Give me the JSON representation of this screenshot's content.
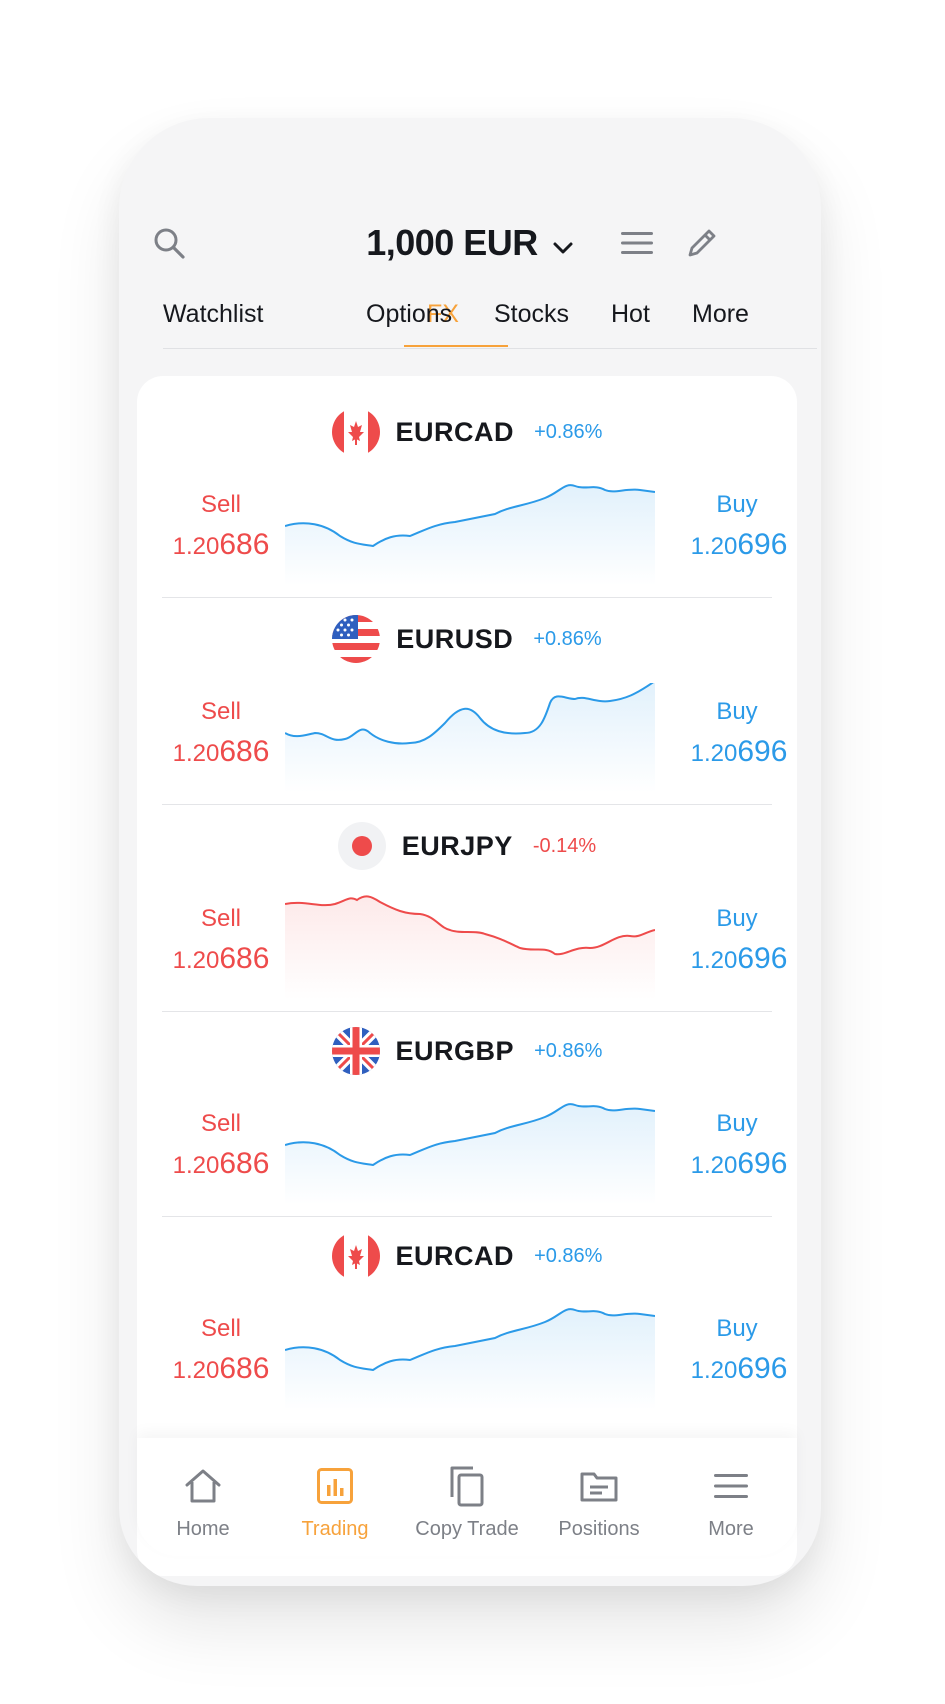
{
  "header": {
    "balance": "1,000 EUR",
    "icons": [
      "search-icon",
      "chevron-down-icon",
      "menu-icon",
      "pencil-icon"
    ]
  },
  "tabs": [
    {
      "label": "Watchlist",
      "active": false
    },
    {
      "label": "FX",
      "active": true
    },
    {
      "label": "Options",
      "active": false
    },
    {
      "label": "Stocks",
      "active": false
    },
    {
      "label": "Hot",
      "active": false
    },
    {
      "label": "More",
      "active": false
    }
  ],
  "instruments": [
    {
      "pair": "EURCAD",
      "change": "+0.86%",
      "flag": "canada-flag-icon",
      "sell_label": "Sell",
      "sell_price": "1.20",
      "sell_pips": "686",
      "buy_label": "Buy",
      "buy_price": "1.20",
      "buy_pips": "696",
      "trend": "up"
    },
    {
      "pair": "EURUSD",
      "change": "+0.86%",
      "flag": "usa-flag-icon",
      "sell_label": "Sell",
      "sell_price": "1.20",
      "sell_pips": "686",
      "buy_label": "Buy",
      "buy_price": "1.20",
      "buy_pips": "696",
      "trend": "up"
    },
    {
      "pair": "EURJPY",
      "change": "-0.14%",
      "flag": "japan-flag-icon",
      "sell_label": "Sell",
      "sell_price": "1.20",
      "sell_pips": "686",
      "buy_label": "Buy",
      "buy_price": "1.20",
      "buy_pips": "696",
      "trend": "down"
    },
    {
      "pair": "EURGBP",
      "change": "+0.86%",
      "flag": "uk-flag-icon",
      "sell_label": "Sell",
      "sell_price": "1.20",
      "sell_pips": "686",
      "buy_label": "Buy",
      "buy_price": "1.20",
      "buy_pips": "696",
      "trend": "up"
    },
    {
      "pair": "EURCAD",
      "change": "+0.86%",
      "flag": "canada-flag-icon",
      "sell_label": "Sell",
      "sell_price": "1.20",
      "sell_pips": "686",
      "buy_label": "Buy",
      "buy_price": "1.20",
      "buy_pips": "696",
      "trend": "up"
    }
  ],
  "bottom_nav": [
    {
      "label": "Home",
      "icon": "home-icon",
      "active": false
    },
    {
      "label": "Trading",
      "icon": "trading-chart-icon",
      "active": true
    },
    {
      "label": "Copy Trade",
      "icon": "copy-icon",
      "active": false
    },
    {
      "label": "Positions",
      "icon": "folder-icon",
      "active": false
    },
    {
      "label": "More",
      "icon": "menu-icon",
      "active": false
    }
  ],
  "colors": {
    "accent": "#f7a23b",
    "sell": "#ee4b4b",
    "buy": "#2b9ae8",
    "text": "#16181d",
    "muted": "#7d8087"
  }
}
